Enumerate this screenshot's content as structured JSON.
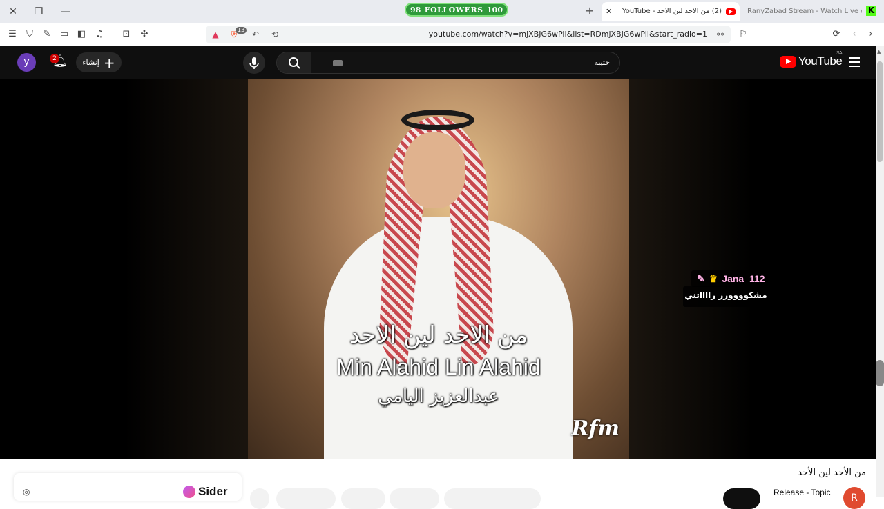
{
  "browser": {
    "followers_left": "98",
    "followers_label": "FOLLOWERS",
    "followers_right": "100",
    "active_tab_title": "(2) من الأحد لين الأحد - YouTube",
    "inactive_tab_title": "RanyZabad Stream - Watch Live on K",
    "url": "youtube.com/watch?v=mjXBJG6wPiI&list=RDmjXBJG6wPiI&start_radio=1",
    "brave_badge": "13"
  },
  "youtube": {
    "avatar_letter": "y",
    "notification_count": "2",
    "create_label": "إنشاء",
    "search_value": "حتيبه",
    "logo_text": "YouTube",
    "logo_region": "SA"
  },
  "video": {
    "overlay_arabic_title": "من الاحد لين الاحد",
    "overlay_latin_title": "Min Alahid Lin Alahid",
    "overlay_artist": "عبدالعزيز اليامي",
    "watermark": "Rfm",
    "chat_username": "Jana_112",
    "chat_message": "مشكوووورر رااااتني"
  },
  "below": {
    "title": "من الأحد لين الأحد",
    "channel": "Release - Topic",
    "channel_initial": "R",
    "sider_label": "Sider"
  }
}
